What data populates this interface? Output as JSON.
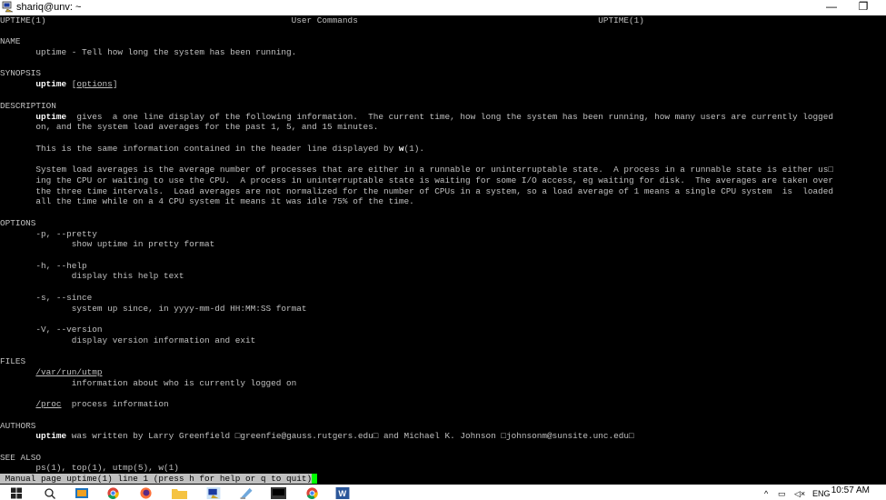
{
  "window": {
    "title": "shariq@unv: ~",
    "minimize_glyph": "—",
    "restore_glyph": "❐"
  },
  "terminal": {
    "lines": [
      {
        "id": "hdr",
        "segs": [
          {
            "t": "UPTIME(1)                                                User Commands                                               UPTIME(1)"
          }
        ]
      },
      {
        "id": "sec-name",
        "segs": [
          {
            "t": "NAME"
          }
        ]
      },
      {
        "id": "name-text",
        "segs": [
          {
            "t": "       uptime - Tell how long the system has been running."
          }
        ]
      },
      {
        "id": "sec-synopsis",
        "segs": [
          {
            "t": "SYNOPSIS"
          }
        ]
      },
      {
        "id": "synopsis-text",
        "segs": [
          {
            "t": "       "
          },
          {
            "t": "uptime",
            "s": "b"
          },
          {
            "t": " ["
          },
          {
            "t": "options",
            "s": "u"
          },
          {
            "t": "]"
          }
        ]
      },
      {
        "id": "sec-description",
        "segs": [
          {
            "t": "DESCRIPTION"
          }
        ]
      },
      {
        "id": "desc-1",
        "segs": [
          {
            "t": "       "
          },
          {
            "t": "uptime",
            "s": "b"
          },
          {
            "t": "  gives  a one line display of the following information.  The current time, how long the system has been running, how many users are currently logged"
          }
        ]
      },
      {
        "id": "desc-2",
        "segs": [
          {
            "t": "       on, and the system load averages for the past 1, 5, and 15 minutes."
          }
        ]
      },
      {
        "id": "desc-3",
        "segs": [
          {
            "t": "       This is the same information contained in the header line displayed by "
          },
          {
            "t": "w",
            "s": "b"
          },
          {
            "t": "(1)."
          }
        ]
      },
      {
        "id": "desc-4",
        "segs": [
          {
            "t": "       System load averages is the average number of processes that are either in a runnable or uninterruptable state.  A process in a runnable state is either us□"
          }
        ]
      },
      {
        "id": "desc-5",
        "segs": [
          {
            "t": "       ing the CPU or waiting to use the CPU.  A process in uninterruptable state is waiting for some I/O access, eg waiting for disk.  The averages are taken over"
          }
        ]
      },
      {
        "id": "desc-6",
        "segs": [
          {
            "t": "       the three time intervals.  Load averages are not normalized for the number of CPUs in a system, so a load average of 1 means a single CPU system  is  loaded"
          }
        ]
      },
      {
        "id": "desc-7",
        "segs": [
          {
            "t": "       all the time while on a 4 CPU system it means it was idle 75% of the time."
          }
        ]
      },
      {
        "id": "sec-options",
        "segs": [
          {
            "t": "OPTIONS"
          }
        ]
      },
      {
        "id": "opt-p",
        "segs": [
          {
            "t": "       -p, --pretty"
          }
        ]
      },
      {
        "id": "opt-p-desc",
        "segs": [
          {
            "t": "              show uptime in pretty format"
          }
        ]
      },
      {
        "id": "opt-h",
        "segs": [
          {
            "t": "       -h, --help"
          }
        ]
      },
      {
        "id": "opt-h-desc",
        "segs": [
          {
            "t": "              display this help text"
          }
        ]
      },
      {
        "id": "opt-s",
        "segs": [
          {
            "t": "       -s, --since"
          }
        ]
      },
      {
        "id": "opt-s-desc",
        "segs": [
          {
            "t": "              system up since, in yyyy-mm-dd HH:MM:SS format"
          }
        ]
      },
      {
        "id": "opt-v",
        "segs": [
          {
            "t": "       -V, --version"
          }
        ]
      },
      {
        "id": "opt-v-desc",
        "segs": [
          {
            "t": "              display version information and exit"
          }
        ]
      },
      {
        "id": "sec-files",
        "segs": [
          {
            "t": "FILES"
          }
        ]
      },
      {
        "id": "file-utmp",
        "segs": [
          {
            "t": "       "
          },
          {
            "t": "/var/run/utmp",
            "s": "u"
          }
        ]
      },
      {
        "id": "file-utmp-desc",
        "segs": [
          {
            "t": "              information about who is currently logged on"
          }
        ]
      },
      {
        "id": "file-proc",
        "segs": [
          {
            "t": "       "
          },
          {
            "t": "/proc",
            "s": "u"
          },
          {
            "t": "  process information"
          }
        ]
      },
      {
        "id": "sec-authors",
        "segs": [
          {
            "t": "AUTHORS"
          }
        ]
      },
      {
        "id": "authors-text",
        "segs": [
          {
            "t": "       "
          },
          {
            "t": "uptime",
            "s": "b"
          },
          {
            "t": " was written by Larry Greenfield □greenfie@gauss.rutgers.edu□ and Michael K. Johnson □johnsonm@sunsite.unc.edu□"
          }
        ]
      },
      {
        "id": "sec-see-also",
        "segs": [
          {
            "t": "SEE ALSO"
          }
        ]
      },
      {
        "id": "see-also-text",
        "segs": [
          {
            "t": "       ps(1), top(1), utmp(5), w(1)"
          }
        ]
      }
    ],
    "status_line": " Manual page uptime(1) line 1 (press h for help or q to quit)"
  },
  "taskbar": {
    "clock": "10:57 AM",
    "language": "ENG",
    "icons": [
      "windows-start-icon",
      "search-icon",
      "task-view-icon",
      "chrome-icon",
      "firefox-icon",
      "file-explorer-icon",
      "putty-icon",
      "notepad-icon",
      "terminal-icon",
      "chrome-icon",
      "word-icon"
    ]
  },
  "colors": {
    "terminal_bg": "#000000",
    "terminal_fg": "#c0c0c0",
    "bold_fg": "#ffffff",
    "cursor": "#00ff00"
  }
}
